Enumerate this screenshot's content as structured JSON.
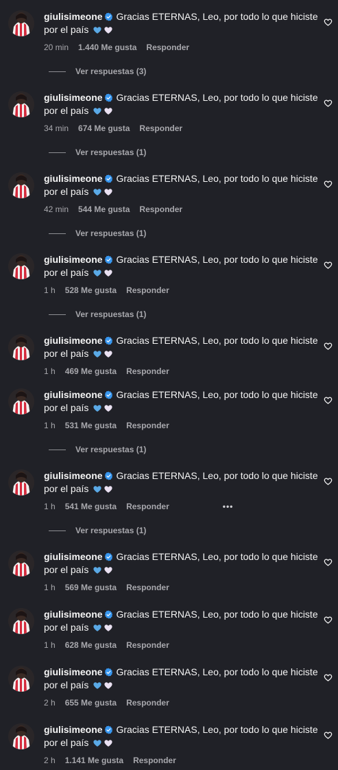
{
  "comments": [
    {
      "username": "giulisimeone",
      "text": "Gracias ETERNAS, Leo, por todo lo que hiciste por el país",
      "time": "20 min",
      "likes": "1.440 Me gusta",
      "reply": "Responder",
      "replies": "Ver respuestas (3)"
    },
    {
      "username": "giulisimeone",
      "text": "Gracias ETERNAS, Leo, por todo lo que hiciste por el país",
      "time": "34 min",
      "likes": "674 Me gusta",
      "reply": "Responder",
      "replies": "Ver respuestas (1)"
    },
    {
      "username": "giulisimeone",
      "text": "Gracias ETERNAS, Leo, por todo lo que hiciste por el país",
      "time": "42 min",
      "likes": "544 Me gusta",
      "reply": "Responder",
      "replies": "Ver respuestas (1)"
    },
    {
      "username": "giulisimeone",
      "text": "Gracias ETERNAS, Leo, por todo lo que hiciste por el país",
      "time": "1 h",
      "likes": "528 Me gusta",
      "reply": "Responder",
      "replies": "Ver respuestas (1)"
    },
    {
      "username": "giulisimeone",
      "text": "Gracias ETERNAS, Leo, por todo lo que hiciste por el país",
      "time": "1 h",
      "likes": "469 Me gusta",
      "reply": "Responder",
      "replies": ""
    },
    {
      "username": "giulisimeone",
      "text": "Gracias ETERNAS, Leo, por todo lo que hiciste por el país",
      "time": "1 h",
      "likes": "531 Me gusta",
      "reply": "Responder",
      "replies": "Ver respuestas (1)"
    },
    {
      "username": "giulisimeone",
      "text": "Gracias ETERNAS, Leo, por todo lo que hiciste por el país",
      "time": "1 h",
      "likes": "541 Me gusta",
      "reply": "Responder",
      "replies": "Ver respuestas (1)",
      "more": "•••"
    },
    {
      "username": "giulisimeone",
      "text": "Gracias ETERNAS, Leo, por todo lo que hiciste por el país",
      "time": "1 h",
      "likes": "569 Me gusta",
      "reply": "Responder",
      "replies": ""
    },
    {
      "username": "giulisimeone",
      "text": "Gracias ETERNAS, Leo, por todo lo que hiciste por el país",
      "time": "1 h",
      "likes": "628 Me gusta",
      "reply": "Responder",
      "replies": ""
    },
    {
      "username": "giulisimeone",
      "text": "Gracias ETERNAS, Leo, por todo lo que hiciste por el país",
      "time": "2 h",
      "likes": "655 Me gusta",
      "reply": "Responder",
      "replies": ""
    },
    {
      "username": "giulisimeone",
      "text": "Gracias ETERNAS, Leo, por todo lo que hiciste por el país",
      "time": "2 h",
      "likes": "1.141 Me gusta",
      "reply": "Responder",
      "replies": ""
    }
  ],
  "icons": {
    "verified": "verified-badge-icon",
    "like": "heart-outline-icon",
    "emoji_1": "blue-heart-emoji",
    "emoji_2": "white-heart-emoji"
  },
  "colors": {
    "background": "#202127",
    "verified": "#3897f0",
    "blue_heart": "#5aa9e6",
    "white_heart": "#eae1f2",
    "secondary_text": "#a8a8ad"
  }
}
